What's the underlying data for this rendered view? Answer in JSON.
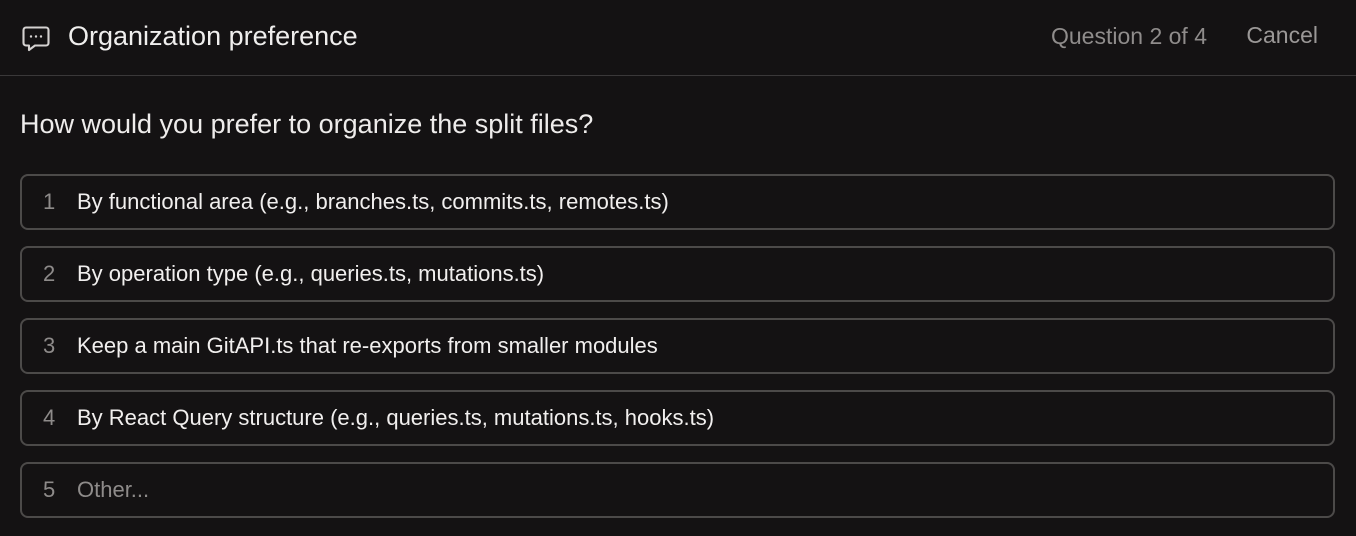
{
  "header": {
    "icon": "message-square-icon",
    "title": "Organization preference",
    "counter": "Question 2 of 4",
    "cancel_label": "Cancel"
  },
  "question": "How would you prefer to organize the split files?",
  "options": [
    {
      "number": "1",
      "label": "By functional area (e.g., branches.ts, commits.ts, remotes.ts)"
    },
    {
      "number": "2",
      "label": "By operation type (e.g., queries.ts, mutations.ts)"
    },
    {
      "number": "3",
      "label": "Keep a main GitAPI.ts that re-exports from smaller modules"
    },
    {
      "number": "4",
      "label": "By React Query structure (e.g., queries.ts, mutations.ts, hooks.ts)"
    },
    {
      "number": "5",
      "label": "Other..."
    }
  ],
  "colors": {
    "background": "#141213",
    "text": "#e9e7e6",
    "muted_text": "#8e8b8a",
    "border": "#4c4a49"
  }
}
